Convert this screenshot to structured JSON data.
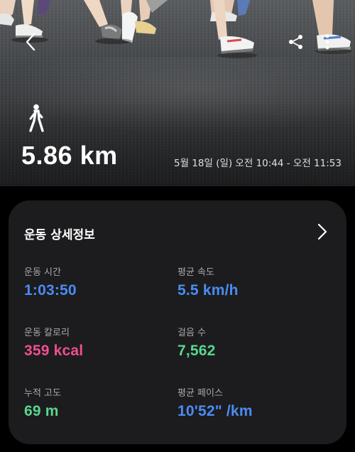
{
  "hero": {
    "distance": "5.86 km",
    "datetime": "5월 18일 (일) 오전 10:44 - 오전 11:53",
    "activity_icon": "walk-icon",
    "back_icon": "chevron-left-icon",
    "share_icon": "share-icon",
    "more_icon": "more-vertical-icon"
  },
  "card": {
    "title": "운동 상세정보",
    "chevron_icon": "chevron-right-icon",
    "stats": [
      {
        "label": "운동 시간",
        "value": "1:03:50"
      },
      {
        "label": "평균 속도",
        "value": "5.5 km/h"
      },
      {
        "label": "운동 칼로리",
        "value": "359 kcal"
      },
      {
        "label": "걸음 수",
        "value": "7,562"
      },
      {
        "label": "누적 고도",
        "value": "69 m"
      },
      {
        "label": "평균 페이스",
        "value": "10'52\" /km"
      }
    ]
  },
  "colors": {
    "blue": "#4a8cf2",
    "pink": "#ef4f8f",
    "green": "#58d68d",
    "card_bg": "#1c1c1e",
    "page_bg": "#000000"
  }
}
